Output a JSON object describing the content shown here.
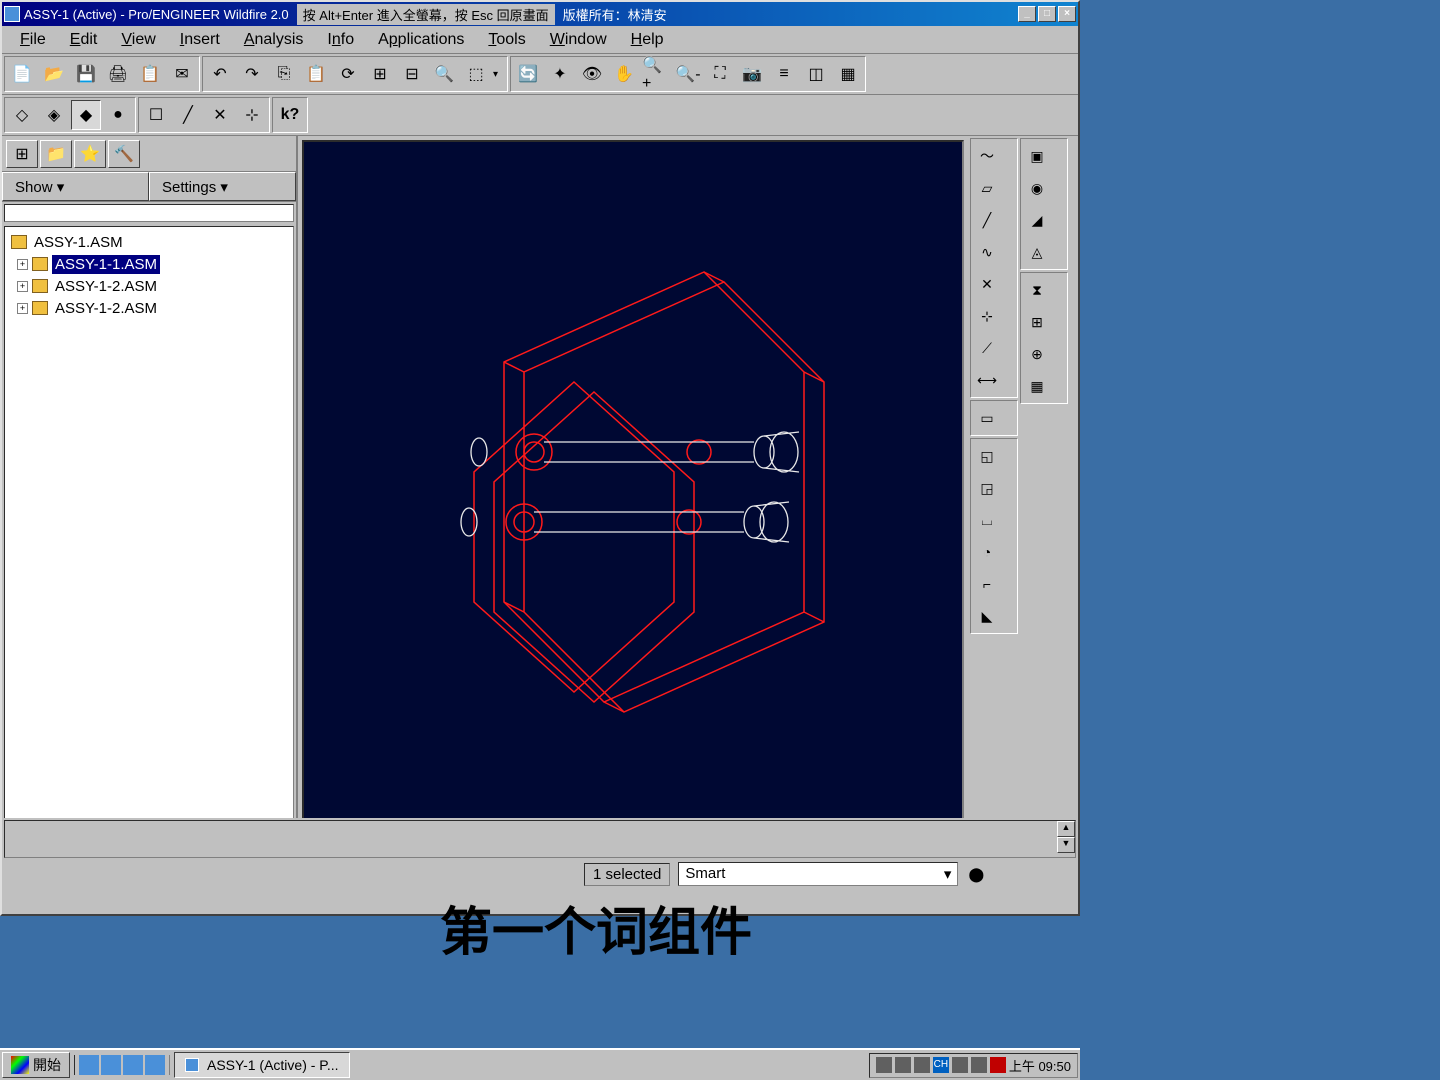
{
  "titlebar": {
    "title": "ASSY-1 (Active) - Pro/ENGINEER Wildfire 2.0",
    "hint": "按 Alt+Enter 進入全螢幕，按 Esc 回原畫面",
    "credit": "版權所有：林清安"
  },
  "menu": {
    "file": "File",
    "edit": "Edit",
    "view": "View",
    "insert": "Insert",
    "analysis": "Analysis",
    "info": "Info",
    "applications": "Applications",
    "tools": "Tools",
    "window": "Window",
    "help": "Help"
  },
  "panel": {
    "show": "Show ▾",
    "settings": "Settings ▾"
  },
  "tree": {
    "root": "ASSY-1.ASM",
    "items": [
      {
        "label": "ASSY-1-1.ASM",
        "selected": true
      },
      {
        "label": "ASSY-1-2.ASM",
        "selected": false
      },
      {
        "label": "ASSY-1-2.ASM",
        "selected": false
      }
    ]
  },
  "status": {
    "selection": "1 selected",
    "filter": "Smart"
  },
  "caption": "第一个词组件",
  "taskbar": {
    "start": "開始",
    "task": "ASSY-1 (Active) - P...",
    "time": "上午 09:50"
  }
}
